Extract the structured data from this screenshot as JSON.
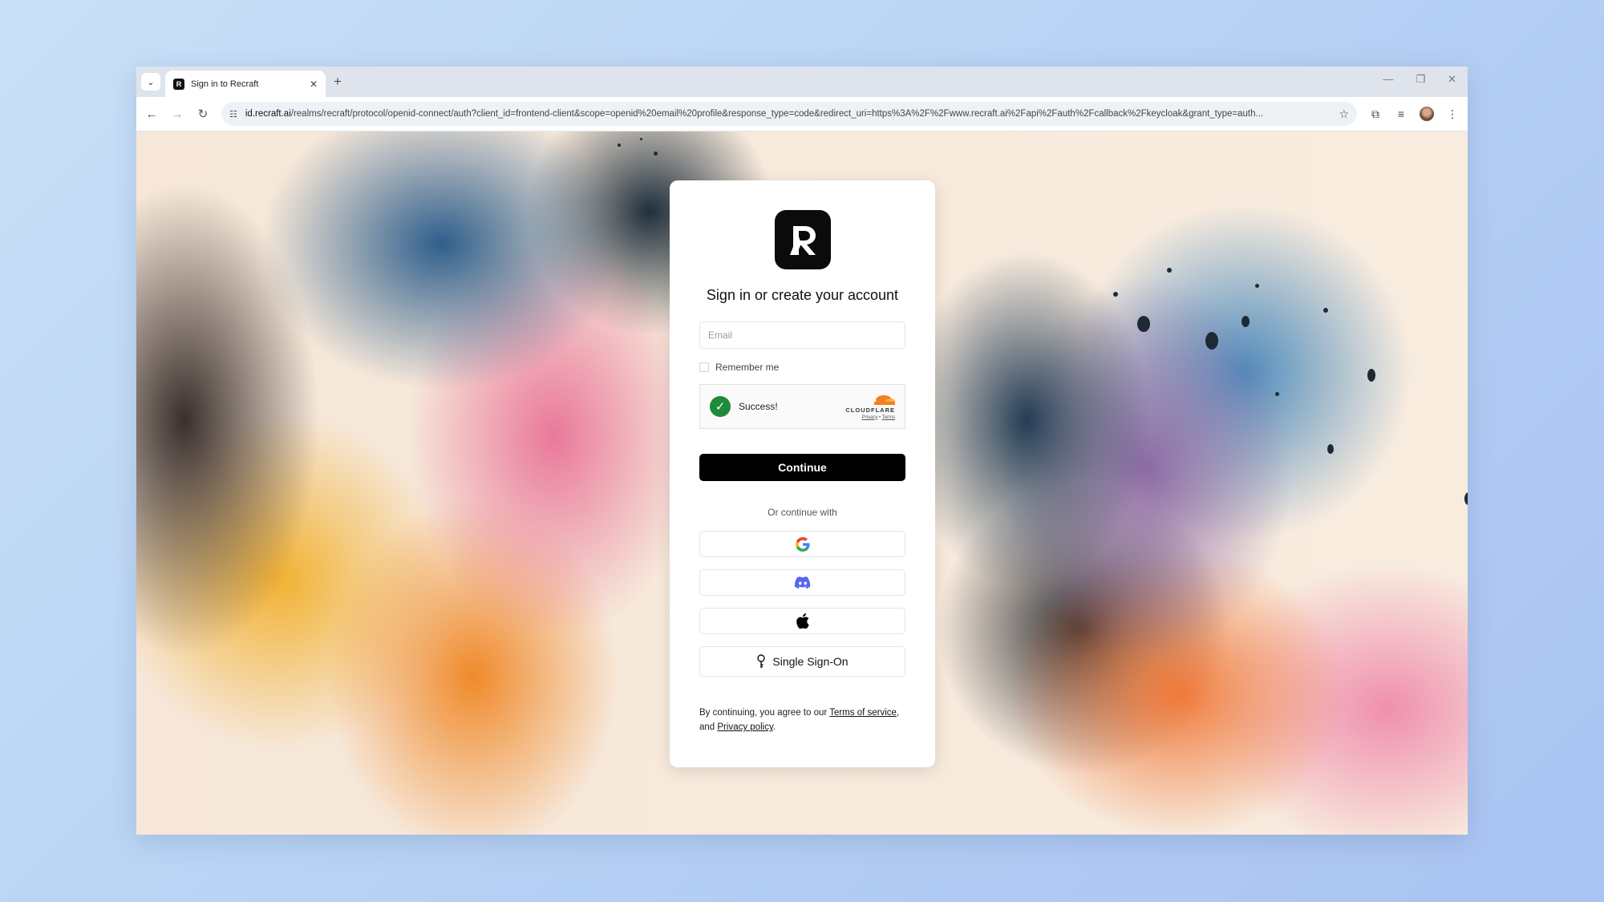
{
  "browser": {
    "tab_title": "Sign in to Recraft",
    "url_domain": "id.recraft.ai",
    "url_path": "/realms/recraft/protocol/openid-connect/auth?client_id=frontend-client&scope=openid%20email%20profile&response_type=code&redirect_uri=https%3A%2F%2Fwww.recraft.ai%2Fapi%2Fauth%2Fcallback%2Fkeycloak&grant_type=auth...",
    "tab_close": "✕",
    "new_tab": "+",
    "minimize": "—",
    "restore": "❐",
    "close": "✕"
  },
  "login": {
    "heading": "Sign in or create your account",
    "email_placeholder": "Email",
    "remember_label": "Remember me",
    "captcha_status": "Success!",
    "captcha_brand": "CLOUDFLARE",
    "captcha_privacy": "Privacy",
    "captcha_sep": " • ",
    "captcha_terms": "Terms",
    "continue_label": "Continue",
    "or_text": "Or continue with",
    "sso_label": "Single Sign-On",
    "terms_prefix": "By continuing, you agree to our ",
    "terms_link": "Terms of service",
    "terms_mid": ", and ",
    "privacy_link": "Privacy policy",
    "terms_suffix": "."
  },
  "icons": {
    "google": "google-icon",
    "discord": "discord-icon",
    "apple": "apple-icon",
    "key": "key-icon"
  },
  "colors": {
    "captcha_success": "#1f8a3b",
    "button_bg": "#000000",
    "cloudflare_orange": "#f38020"
  }
}
